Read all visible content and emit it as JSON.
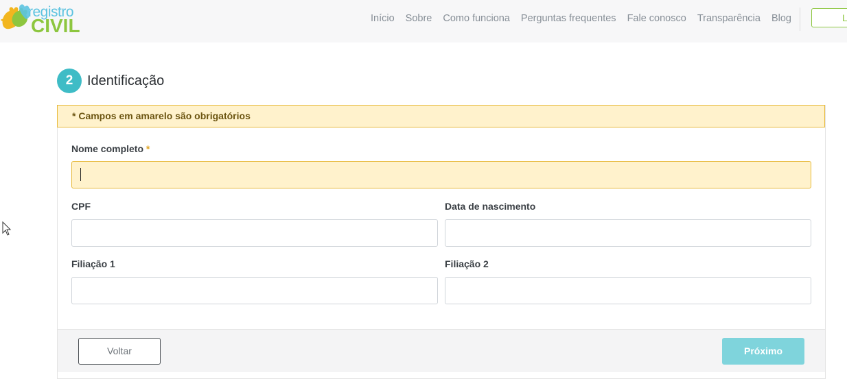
{
  "header": {
    "logo": {
      "line1": "registro",
      "line2": "CIVIL"
    },
    "nav": [
      "Início",
      "Sobre",
      "Como funciona",
      "Perguntas frequentes",
      "Fale conosco",
      "Transparência",
      "Blog"
    ],
    "login_label": "L"
  },
  "step": {
    "number": "2",
    "title": "Identificação"
  },
  "notice": "* Campos em amarelo são obrigatórios",
  "form": {
    "nome_label": "Nome completo",
    "required_mark": "*",
    "nome_value": "",
    "cpf_label": "CPF",
    "cpf_value": "",
    "nascimento_label": "Data de nascimento",
    "nascimento_value": "",
    "filiacao1_label": "Filiação 1",
    "filiacao1_value": "",
    "filiacao2_label": "Filiação 2",
    "filiacao2_value": ""
  },
  "buttons": {
    "back": "Voltar",
    "next": "Próximo"
  },
  "colors": {
    "accent_teal": "#3fbcc6",
    "required_yellow": "#fff2cc",
    "brand_green": "#8dc63f",
    "brand_blue": "#5cc3e0"
  }
}
